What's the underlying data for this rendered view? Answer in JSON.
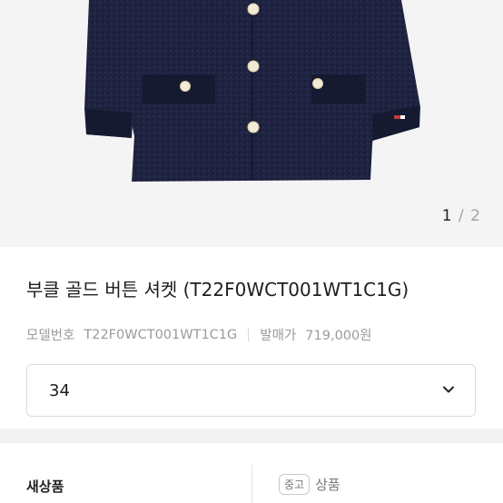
{
  "product": {
    "image_alt": "navy tweed jacket with gold buttons",
    "pager": {
      "current": "1",
      "separator": "/",
      "total": "2"
    },
    "title": "부클 골드 버튼 셔켓 (T22F0WCT001WT1C1G)",
    "model_label": "모델번호",
    "model_value": "T22F0WCT001WT1C1G",
    "price_label": "발매가",
    "price_value": "719,000원"
  },
  "size_select": {
    "value": "34",
    "icon": "chevron-down-icon"
  },
  "condition": {
    "left_label": "새상품",
    "right_tag": "중고",
    "right_label": "상품"
  },
  "colors": {
    "jacket": "#1b1f3a",
    "button": "#f3ead7",
    "background": "#f4f4f4"
  }
}
